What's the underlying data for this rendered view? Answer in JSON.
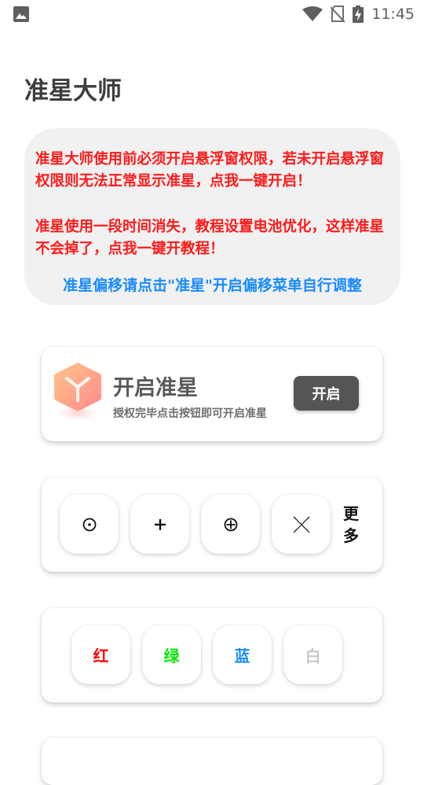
{
  "status_bar": {
    "time": "11:45",
    "icons": [
      "gallery-icon",
      "wifi-icon",
      "no-sim-icon",
      "battery-charging-icon"
    ]
  },
  "page": {
    "title": "准星大师"
  },
  "notice": {
    "permission_text": "准星大师使用前必须开启悬浮窗权限，若未开启悬浮窗权限则无法正常显示准星，点我一键开启！",
    "battery_text": "准星使用一段时间消失，教程设置电池优化，这样准星不会掉了，点我一键开教程！",
    "offset_text": "准星偏移请点击\"准星\"开启偏移菜单自行调整",
    "colors": {
      "warning": "#ff1a1a",
      "link": "#1a8cff"
    }
  },
  "enable_card": {
    "title": "开启准星",
    "subtitle": "授权完毕点击按钮即可开启准星",
    "button_label": "开启",
    "icon": "cube-logo-icon"
  },
  "crosshair_styles": {
    "buttons": [
      {
        "icon": "dot-circle-crosshair-icon"
      },
      {
        "icon": "plus-crosshair-icon"
      },
      {
        "icon": "circle-plus-crosshair-icon"
      },
      {
        "icon": "x-crosshair-icon"
      }
    ],
    "more_label": "更多"
  },
  "crosshair_colors": {
    "buttons": [
      {
        "label": "红",
        "color": "#ff0000"
      },
      {
        "label": "绿",
        "color": "#00e600"
      },
      {
        "label": "蓝",
        "color": "#1a8cff"
      },
      {
        "label": "白",
        "color": "#c8c8c8"
      }
    ]
  }
}
